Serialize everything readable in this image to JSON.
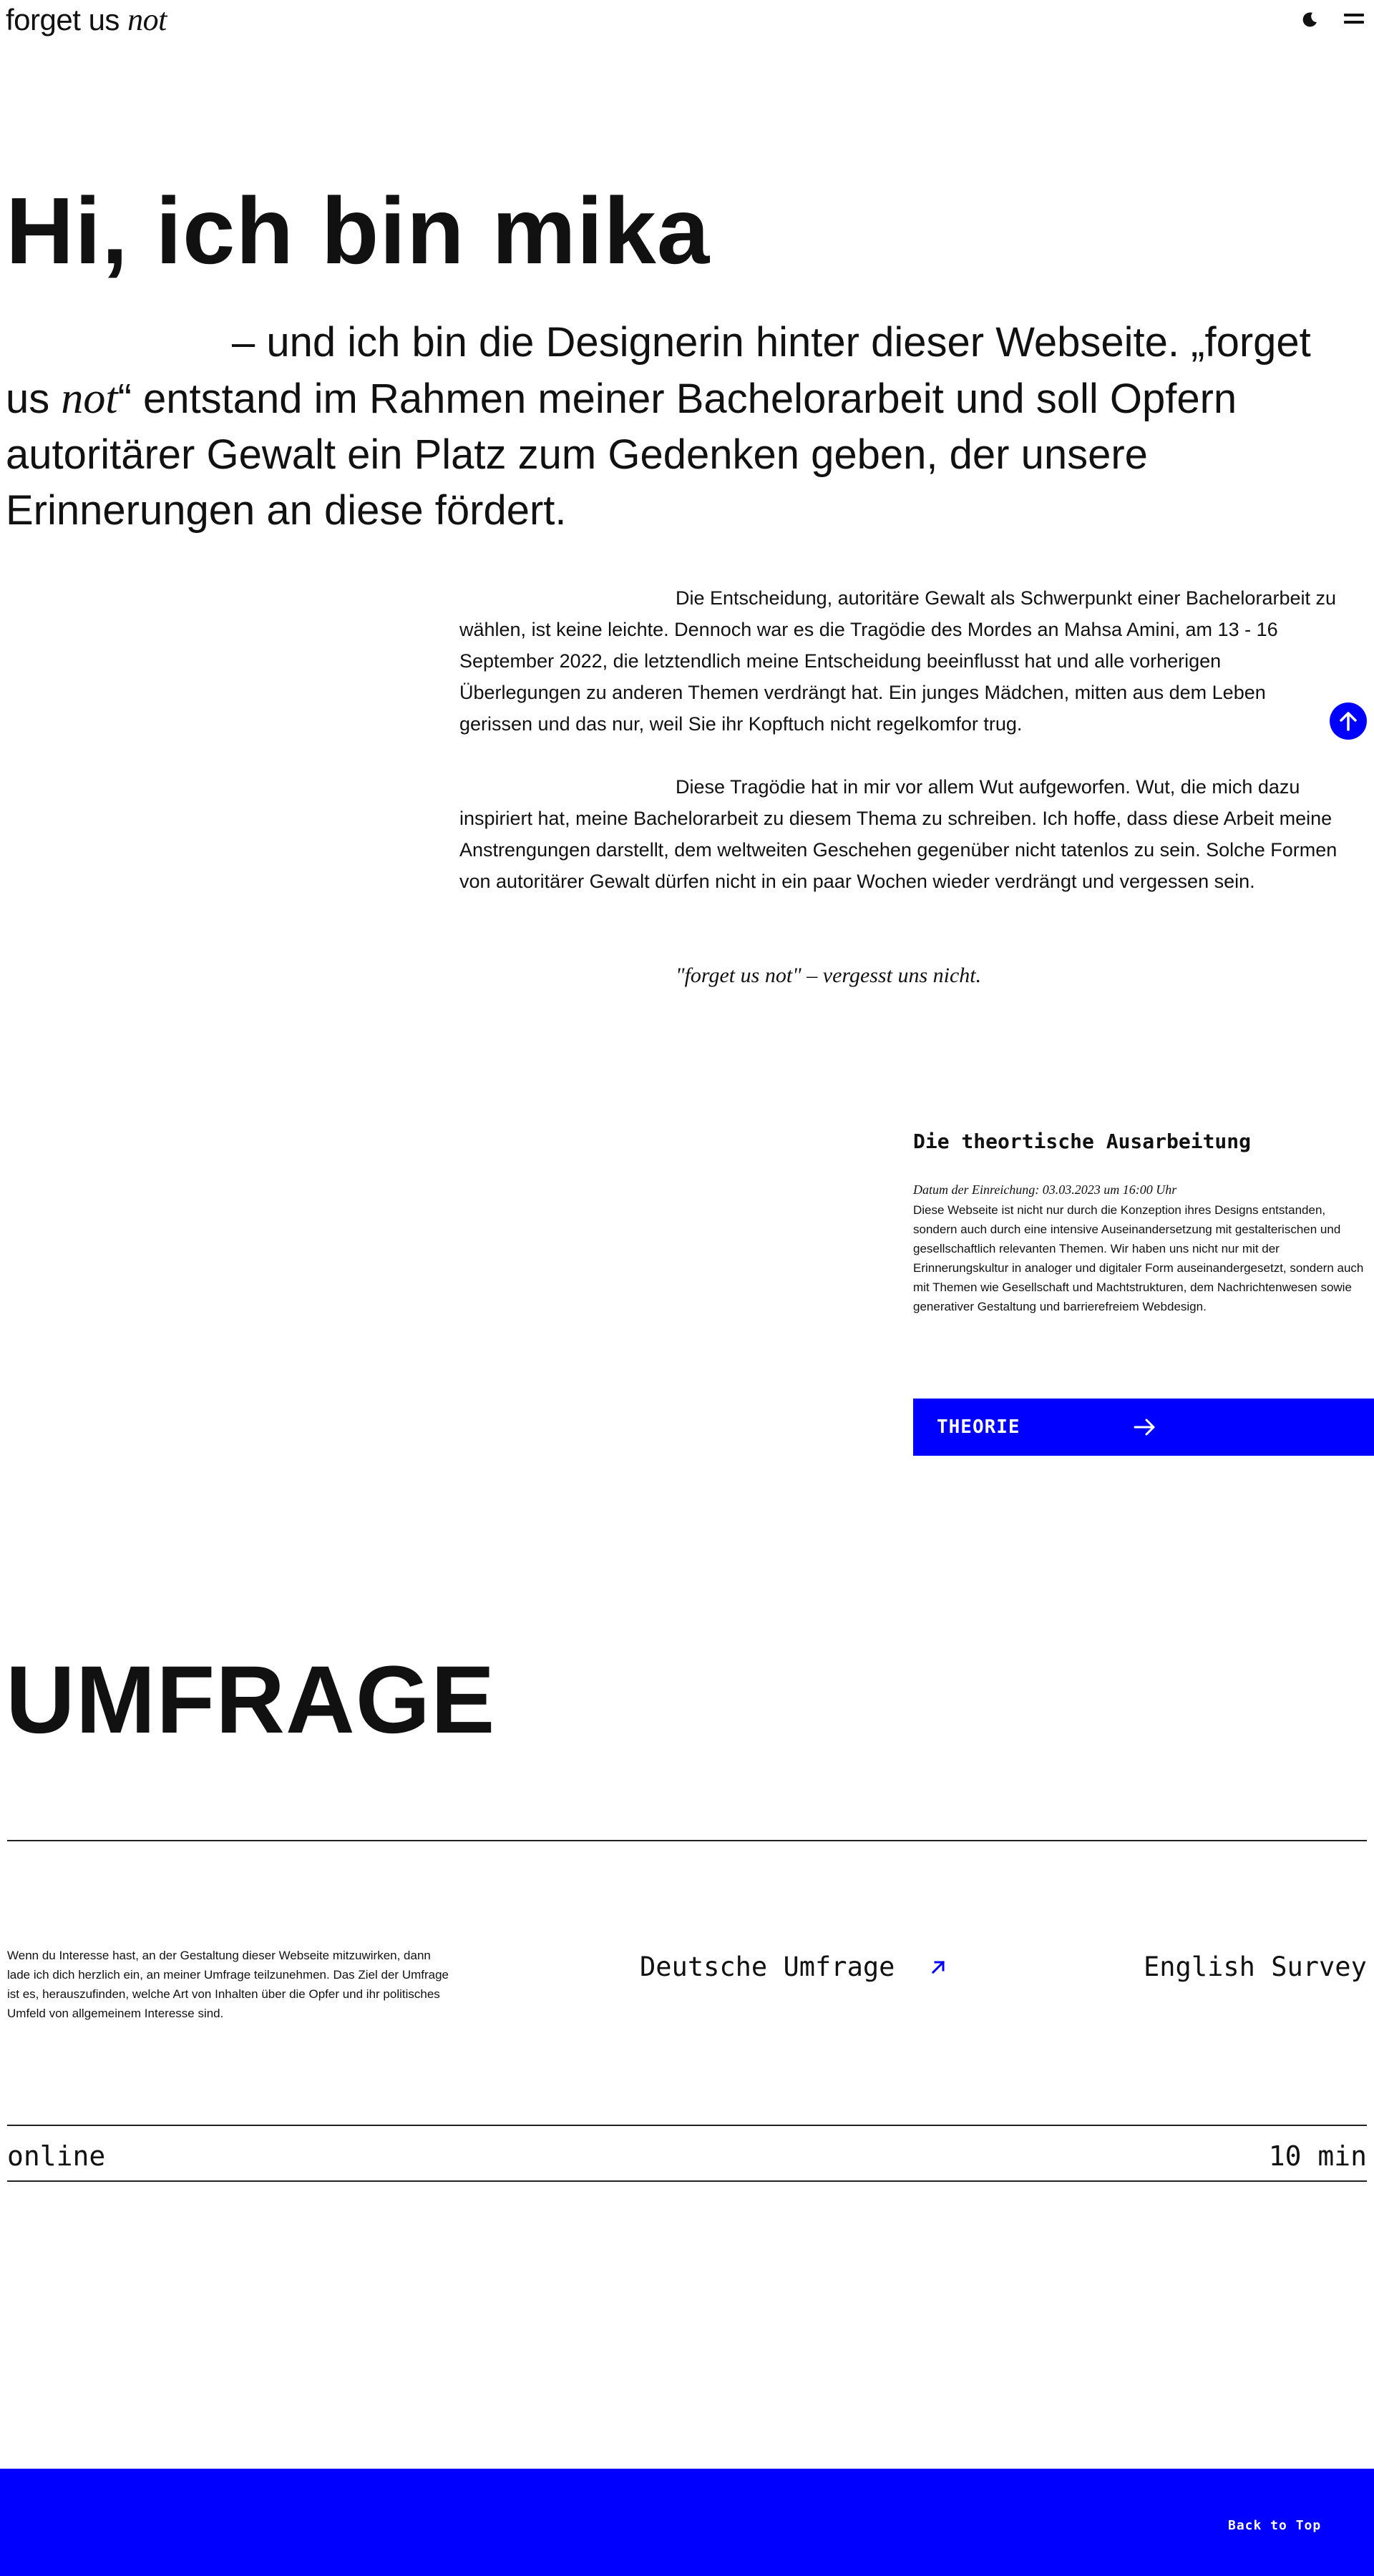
{
  "header": {
    "logo_text": "forget us",
    "logo_emphasis": "not",
    "theme_icon": "moon-icon",
    "menu_icon": "hamburger-menu-icon"
  },
  "hero": {
    "title": "Hi, ich bin mika",
    "intro_part1": "– und ich bin die Designerin hinter dieser Webseite. „forget us ",
    "intro_emphasis": "not",
    "intro_part2": "“ entstand im Rahmen meiner Bachelorarbeit und soll Opfern autoritärer Gewalt ein Platz zum Gedenken geben, der unsere Erinnerungen an diese fördert."
  },
  "story": {
    "paragraph1": "Die Entscheidung, autoritäre Gewalt als Schwerpunkt einer Bachelorarbeit zu wählen, ist keine leichte. Dennoch war es die Tragödie des Mordes an Mahsa Amini, am 13 - 16 September 2022, die letztendlich meine Entscheidung beeinflusst hat und alle vorherigen Überlegungen zu anderen Themen verdrängt hat. Ein junges Mädchen, mitten aus dem Leben gerissen und das nur, weil Sie ihr Kopftuch nicht regelkomfor trug.",
    "paragraph2": "Diese Tragödie hat in mir vor allem Wut aufgeworfen. Wut, die mich dazu inspiriert hat, meine Bachelorarbeit zu diesem Thema zu schreiben. Ich hoffe, dass diese Arbeit meine Anstrengungen darstellt, dem weltweiten Geschehen gegenüber nicht tatenlos zu sein. Solche Formen von autoritärer Gewalt dürfen nicht in ein paar Wochen wieder verdrängt und vergessen sein.",
    "quote": "\"forget us not\" – vergesst uns nicht."
  },
  "theory": {
    "heading": "Die theortische Ausarbeitung",
    "date": "Datum der Einreichung: 03.03.2023 um 16:00 Uhr",
    "text": "Diese Webseite ist nicht nur durch die Konzeption ihres Designs entstanden, sondern auch durch eine intensive Auseinandersetzung mit gestalterischen und gesellschaftlich relevanten Themen. Wir haben uns nicht nur mit der Erinnerungskultur in analoger und digitaler Form auseinandergesetzt, sondern auch mit Themen wie Gesellschaft und Machtstrukturen, dem Nachrichtenwesen sowie generativer Gestaltung und barrierefreiem Webdesign.",
    "button_label": "THEORIE",
    "button_icon": "arrow-right-icon"
  },
  "survey": {
    "title": "UMFRAGE",
    "text": "Wenn du Interesse hast, an der Gestaltung dieser Webseite mitzuwirken, dann lade ich dich herzlich ein, an meiner Umfrage teilzunehmen. Das Ziel der Umfrage ist es, herauszufinden, welche Art von Inhalten über die Opfer und ihr politisches Umfeld von allgemeinem Interesse sind.",
    "link_de": "Deutsche Umfrage",
    "link_en": "English Survey",
    "link_icon": "arrow-up-right-icon",
    "mode": "online",
    "duration": "10 min"
  },
  "footer": {
    "back_to_top": "Back to Top",
    "fab_icon": "arrow-up-icon"
  },
  "colors": {
    "accent": "#0000ff",
    "text": "#111111",
    "background": "#ffffff"
  }
}
